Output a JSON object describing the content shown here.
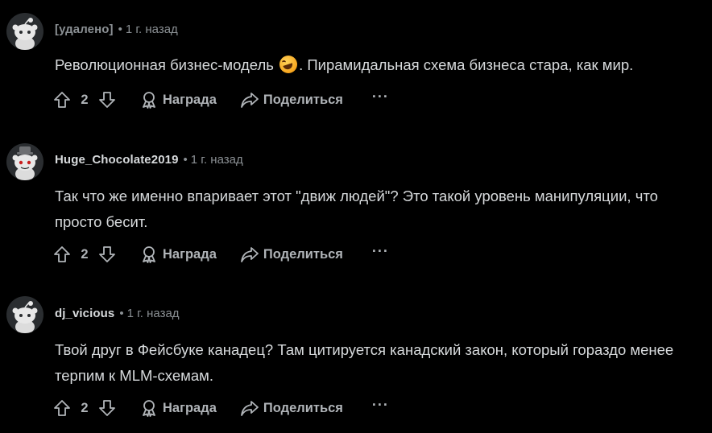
{
  "comments": [
    {
      "author": "[удалено]",
      "separator": "•",
      "time": "1 г. назад",
      "text_before_emoji": "Революционная бизнес-модель",
      "emoji": "rolling-on-the-floor-laughing-emoji",
      "text_after_emoji": ". Пирамидальная схема бизнеса стара, как мир.",
      "score": "2",
      "award_label": "Награда",
      "share_label": "Поделиться",
      "more_label": "···"
    },
    {
      "author": "Huge_Chocolate2019",
      "separator": "•",
      "time": "1 г. назад",
      "text": "Так что же именно впаривает этот \"движ людей\"? Это такой уровень манипуляции, что просто бесит.",
      "score": "2",
      "award_label": "Награда",
      "share_label": "Поделиться",
      "more_label": "···"
    },
    {
      "author": "dj_vicious",
      "separator": "•",
      "time": "1 г. назад",
      "text": "Твой друг в Фейсбуке канадец? Там цитируется канадский закон, который гораздо менее терпим к MLM-схемам.",
      "score": "2",
      "award_label": "Награда",
      "share_label": "Поделиться",
      "more_label": "···"
    }
  ],
  "colors": {
    "background": "#000000",
    "text": "#d7dadc",
    "muted": "#8b9094",
    "action": "#b0b4b8"
  }
}
